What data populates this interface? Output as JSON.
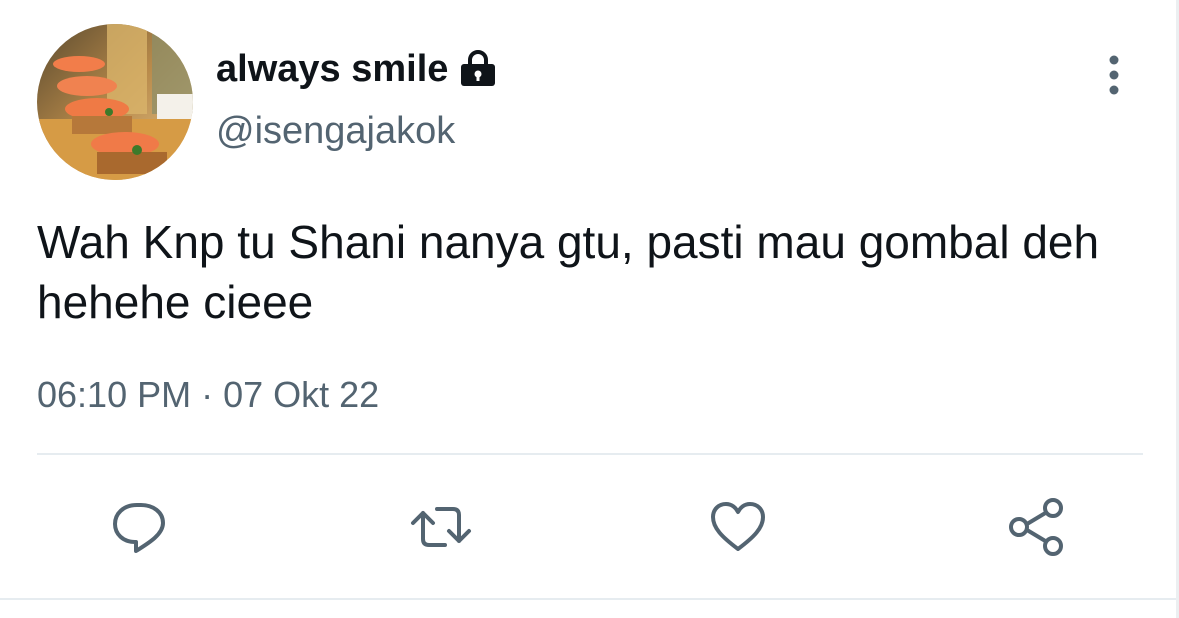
{
  "user": {
    "display_name": "always smile",
    "handle": "@isengajakok",
    "avatar_icon": "sushi-photo-avatar",
    "protected": true,
    "lock_icon": "lock-icon"
  },
  "tweet": {
    "text": "Wah Knp tu Shani nanya gtu, pasti mau gombal deh hehehe cieee",
    "timestamp": "06:10 PM · 07 Okt 22"
  },
  "actions": {
    "reply_icon": "reply-icon",
    "retweet_icon": "retweet-icon",
    "like_icon": "heart-icon",
    "share_icon": "share-icon"
  },
  "menu": {
    "more_icon": "more-vertical-icon"
  },
  "colors": {
    "text_primary": "#0f1419",
    "text_secondary": "#536471",
    "icon_gray": "#536471",
    "divider": "#e6ecf0"
  }
}
